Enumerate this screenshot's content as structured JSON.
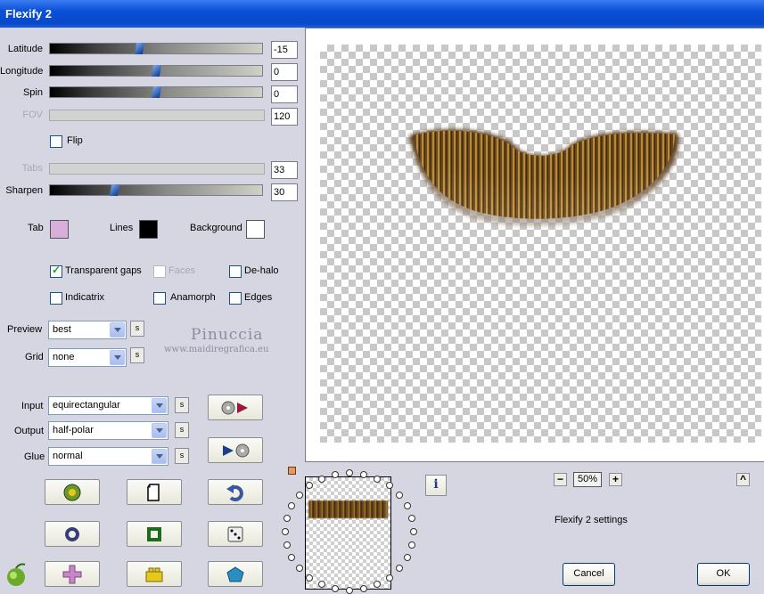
{
  "window": {
    "title": "Flexify 2"
  },
  "sliders": [
    {
      "label": "Latitude",
      "value": "-15",
      "pos": 0.42,
      "enabled": true
    },
    {
      "label": "Longitude",
      "value": "0",
      "pos": 0.5,
      "enabled": true
    },
    {
      "label": "Spin",
      "value": "0",
      "pos": 0.5,
      "enabled": true
    },
    {
      "label": "FOV",
      "value": "120",
      "enabled": false
    },
    {
      "label": "Tabs",
      "value": "33",
      "enabled": false
    },
    {
      "label": "Sharpen",
      "value": "30",
      "pos": 0.3,
      "enabled": true
    }
  ],
  "flip": {
    "label": "Flip",
    "checked": false
  },
  "colors": {
    "tab": {
      "label": "Tab",
      "color": "#d8aedb"
    },
    "lines": {
      "label": "Lines",
      "color": "#000000"
    },
    "background": {
      "label": "Background",
      "color": "#ffffff"
    }
  },
  "checkboxes": {
    "transparent_gaps": {
      "label": "Transparent gaps",
      "checked": true
    },
    "faces": {
      "label": "Faces",
      "checked": false,
      "enabled": false
    },
    "de_halo": {
      "label": "De-halo",
      "checked": false
    },
    "indicatrix": {
      "label": "Indicatrix",
      "checked": false
    },
    "anamorph": {
      "label": "Anamorph",
      "checked": false
    },
    "edges": {
      "label": "Edges",
      "checked": false
    }
  },
  "selects": {
    "preview": {
      "label": "Preview",
      "value": "best"
    },
    "grid": {
      "label": "Grid",
      "value": "none"
    },
    "input": {
      "label": "Input",
      "value": "equirectangular"
    },
    "output": {
      "label": "Output",
      "value": "half-polar"
    },
    "glue": {
      "label": "Glue",
      "value": "normal"
    }
  },
  "s_label": "s",
  "watermark": {
    "name": "Pinuccia",
    "url": "www.maidiregrafica.eu"
  },
  "zoom": {
    "minus": "−",
    "value": "50%",
    "plus": "+",
    "up": "^"
  },
  "settings_name": "Flexify 2 settings",
  "info_label": "i",
  "buttons": {
    "cancel": "Cancel",
    "ok": "OK"
  },
  "icons": {
    "tool_buttons": [
      "globe-icon",
      "page-icon",
      "undo-icon",
      "ring-icon",
      "square-frame-icon",
      "dice-icon",
      "cross-icon",
      "lego-brick-icon",
      "pentagon-icon"
    ],
    "logo": "apple-logo-icon"
  }
}
